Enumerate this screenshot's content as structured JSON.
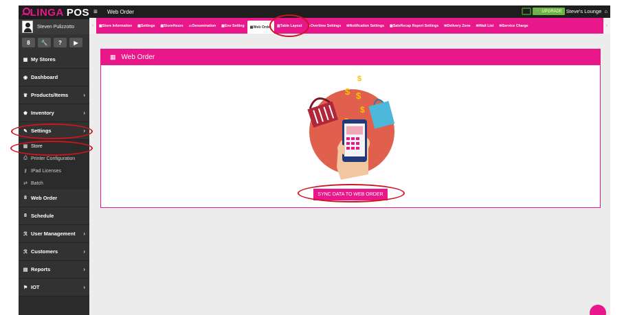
{
  "brand": {
    "name": "LINGA",
    "suffix": "POS"
  },
  "user": {
    "name": "Steven Pulizzotto"
  },
  "quick_actions": [
    "8",
    "🔧",
    "?",
    "▶"
  ],
  "sidebar": {
    "items": [
      {
        "label": "My Stores",
        "icon": "store-icon"
      },
      {
        "label": "Dashboard",
        "icon": "dashboard-icon"
      },
      {
        "label": "Products/Items",
        "icon": "products-icon",
        "chevron": "›"
      },
      {
        "label": "Inventory",
        "icon": "inventory-icon",
        "chevron": "›"
      },
      {
        "label": "Settings",
        "icon": "wrench-icon",
        "chevron": "›"
      }
    ],
    "sub_items": [
      {
        "label": "Store",
        "icon": "store-icon"
      },
      {
        "label": "Printer Configuration",
        "icon": "printer-icon"
      },
      {
        "label": "IPad Licenses",
        "icon": "key-icon"
      },
      {
        "label": "Batch",
        "icon": "exchange-icon"
      }
    ],
    "items2": [
      {
        "label": "Web Order",
        "icon": "web-order-icon"
      },
      {
        "label": "Schedule",
        "icon": "schedule-icon"
      },
      {
        "label": "User Management",
        "icon": "users-icon",
        "chevron": "›"
      },
      {
        "label": "Customers",
        "icon": "customers-icon",
        "chevron": "›"
      },
      {
        "label": "Reports",
        "icon": "reports-icon",
        "chevron": "›"
      },
      {
        "label": "IOT",
        "icon": "iot-icon",
        "chevron": "›"
      }
    ]
  },
  "header": {
    "title": "Web Order",
    "upgrade_label": "UPGRADE",
    "store_name": "Steve's Lounge"
  },
  "tabs": [
    "Store Information",
    "Settings",
    "StoreHours",
    "Denomination",
    "Env Setting",
    "Web Order",
    "Table Layout",
    "Overtime Settings",
    "Notification Settings",
    "SaleRecap Report Settings",
    "Delivery Zone",
    "Wait List",
    "Service Charge"
  ],
  "active_tab": "Web Order",
  "panel": {
    "title": "Web Order",
    "button_label": "SYNC DATA TO WEB ORDER"
  },
  "colors": {
    "accent": "#e8178a",
    "sidebar": "#2b2b2b",
    "annotation": "#d0141e"
  }
}
